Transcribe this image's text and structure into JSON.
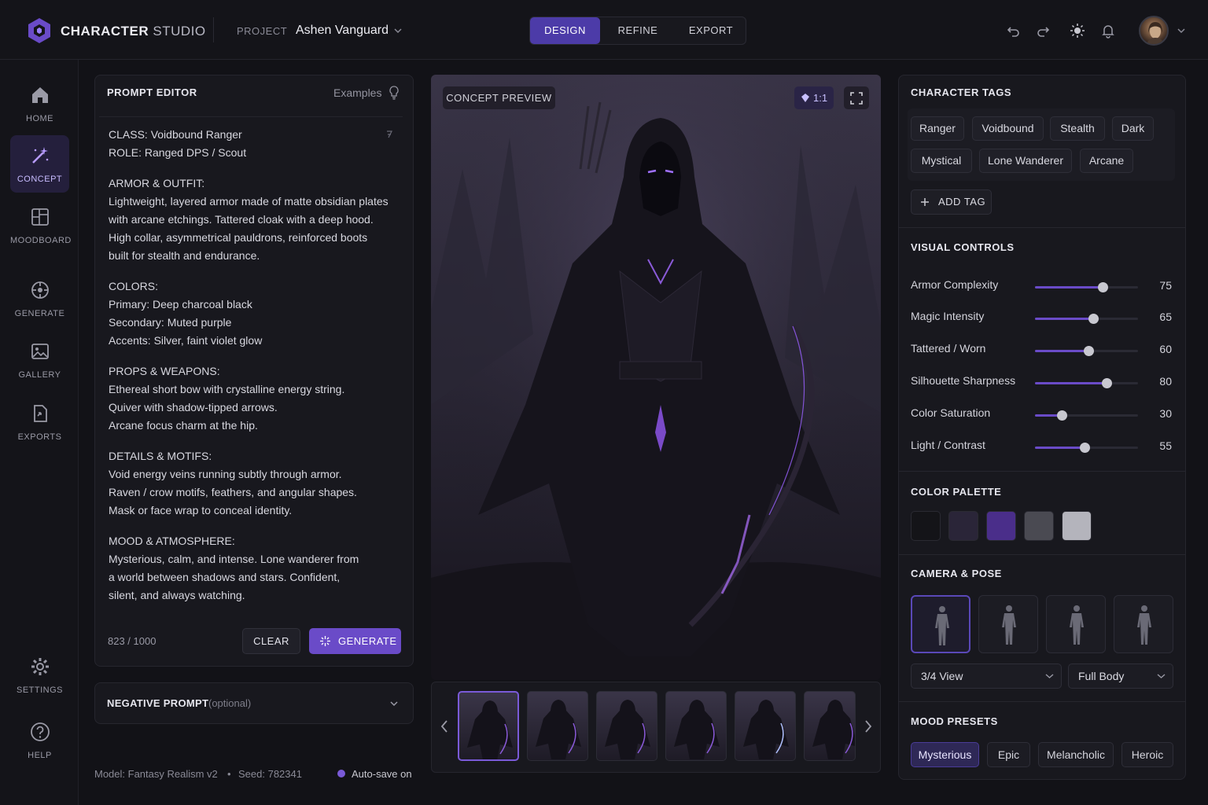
{
  "header": {
    "brand_bold": "CHARACTER",
    "brand_light": " STUDIO",
    "project_label": "PROJECT",
    "project_name": "Ashen Vanguard",
    "modes": [
      "DESIGN",
      "REFINE",
      "EXPORT"
    ],
    "active_mode": "DESIGN",
    "icons": [
      "undo-icon",
      "redo-icon",
      "theme-sun-icon",
      "bell-icon",
      "chevron-down-icon"
    ]
  },
  "sidebar": {
    "items": [
      {
        "label": "HOME",
        "icon": "home-icon"
      },
      {
        "label": "CONCEPT",
        "icon": "magic-wand-icon",
        "active": true
      },
      {
        "label": "MOODBOARD",
        "icon": "moodboard-icon"
      },
      {
        "label": "GENERATE",
        "icon": "generate-icon"
      },
      {
        "label": "GALLERY",
        "icon": "image-icon"
      },
      {
        "label": "EXPORTS",
        "icon": "export-icon"
      },
      {
        "label": "SETTINGS",
        "icon": "gear-icon"
      },
      {
        "label": "HELP",
        "icon": "help-icon"
      }
    ]
  },
  "prompt_editor": {
    "title": "PROMPT EDITOR",
    "examples_label": "Examples",
    "sections": [
      "CLASS:  Voidbound Ranger\nROLE:  Ranged DPS / Scout",
      "ARMOR & OUTFIT:\nLightweight, layered armor made of matte obsidian plates\nwith arcane etchings. Tattered cloak with a deep hood.\nHigh collar, asymmetrical pauldrons, reinforced boots\nbuilt for stealth and endurance.",
      "COLORS:\nPrimary:  Deep charcoal black\nSecondary:  Muted purple\nAccents:  Silver, faint violet glow",
      "PROPS & WEAPONS:\nEthereal short bow with crystalline energy string.\nQuiver with shadow-tipped arrows.\nArcane focus charm at the hip.",
      "DETAILS & MOTIFS:\nVoid energy veins running subtly through armor.\nRaven / crow motifs, feathers, and angular shapes.\nMask or face wrap to conceal identity.",
      "MOOD & ATMOSPHERE:\nMysterious, calm, and intense. Lone wanderer from\na world between shadows and stars. Confident,\nsilent, and always watching."
    ],
    "char_count": "823 / 1000",
    "clear_label": "CLEAR",
    "generate_label": "GENERATE"
  },
  "negative_prompt": {
    "title": "NEGATIVE PROMPT",
    "optional": "(optional)"
  },
  "status": {
    "model": "Model:  Fantasy Realism v2",
    "sep": "•",
    "seed": "Seed:  782341",
    "autosave": "Auto-save on"
  },
  "preview": {
    "label": "CONCEPT PREVIEW",
    "ratio": "1:1",
    "thumb_count": 6,
    "active_thumb": 0
  },
  "character_tags": {
    "title": "CHARACTER TAGS",
    "tags": [
      "Ranger",
      "Voidbound",
      "Stealth",
      "Dark",
      "Mystical",
      "Lone Wanderer",
      "Arcane"
    ],
    "add_label": "ADD TAG"
  },
  "visual_controls": {
    "title": "VISUAL CONTROLS",
    "items": [
      {
        "label": "Armor Complexity",
        "value": 75
      },
      {
        "label": "Magic Intensity",
        "value": 65
      },
      {
        "label": "Tattered / Worn",
        "value": 60
      },
      {
        "label": "Silhouette Sharpness",
        "value": 80
      },
      {
        "label": "Color Saturation",
        "value": 30
      },
      {
        "label": "Light / Contrast",
        "value": 55
      }
    ]
  },
  "color_palette": {
    "title": "COLOR PALETTE",
    "colors": [
      "#141418",
      "#2a2538",
      "#4a2e8a",
      "#4a4a52",
      "#b4b4bc"
    ]
  },
  "camera_pose": {
    "title": "CAMERA & POSE",
    "view": "3/4 View",
    "framing": "Full Body",
    "active_pose": 0
  },
  "mood_presets": {
    "title": "MOOD PRESETS",
    "presets": [
      "Mysterious",
      "Epic",
      "Melancholic",
      "Heroic"
    ],
    "active": "Mysterious"
  }
}
